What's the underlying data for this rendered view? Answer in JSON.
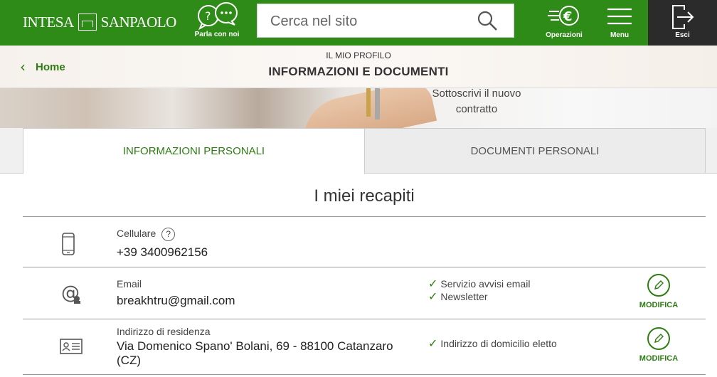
{
  "header": {
    "logo_left": "INTESA",
    "logo_right": "SANPAOLO",
    "chat_label": "Parla con noi",
    "search_placeholder": "Cerca nel sito",
    "operations_label": "Operazioni",
    "menu_label": "Menu",
    "exit_label": "Esci"
  },
  "breadcrumb": {
    "home": "Home",
    "section": "IL MIO PROFILO",
    "page": "INFORMAZIONI E DOCUMENTI"
  },
  "banner": {
    "promo_line1": "Sottoscrivi il nuovo",
    "promo_line2": "contratto"
  },
  "tabs": [
    {
      "label": "INFORMAZIONI PERSONALI",
      "active": true
    },
    {
      "label": "DOCUMENTI PERSONALI",
      "active": false
    }
  ],
  "contacts": {
    "title": "I miei recapiti",
    "mobile": {
      "label": "Cellulare",
      "help": "?",
      "value": "+39 3400962156"
    },
    "email": {
      "label": "Email",
      "value": "breakhtru@gmail.com",
      "checks": [
        "Servizio avvisi email",
        "Newsletter"
      ],
      "action": "MODIFICA"
    },
    "address": {
      "label": "Indirizzo di residenza",
      "value_line1": "Via Domenico Spano' Bolani, 69 - 88100 Catanzaro",
      "value_line2": "(CZ)",
      "checks": [
        "Indirizzo di domicilio eletto"
      ],
      "action": "MODIFICA"
    }
  },
  "colors": {
    "brand_green": "#2e8b17",
    "link_green": "#2e7d13",
    "exit_bg": "#2b2b2b"
  }
}
